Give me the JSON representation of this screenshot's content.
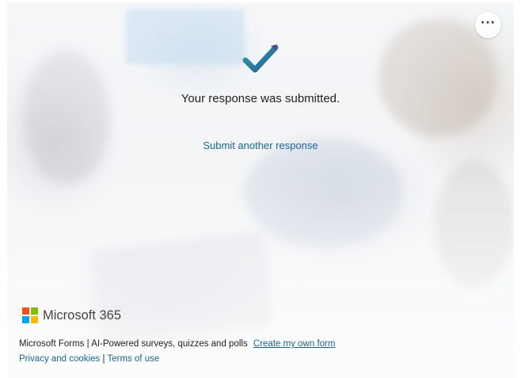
{
  "page": {
    "title": "Your response was submitted.",
    "submit_another": "Submit another response",
    "more_icon": "ellipsis-icon",
    "success_icon": "checkmark-icon"
  },
  "brand": {
    "name": "Microsoft 365",
    "logo_colors": [
      "#f25022",
      "#7fba00",
      "#00a4ef",
      "#ffb900"
    ]
  },
  "footer": {
    "product": "Microsoft Forms",
    "separator": "|",
    "tagline": "AI-Powered surveys, quizzes and polls",
    "create_link": "Create my own form",
    "privacy_link": "Privacy and cookies",
    "terms_link": "Terms of use"
  },
  "colors": {
    "link": "#1a6599",
    "check_teal": "#2aa6a0",
    "check_blue": "#2b579a"
  }
}
